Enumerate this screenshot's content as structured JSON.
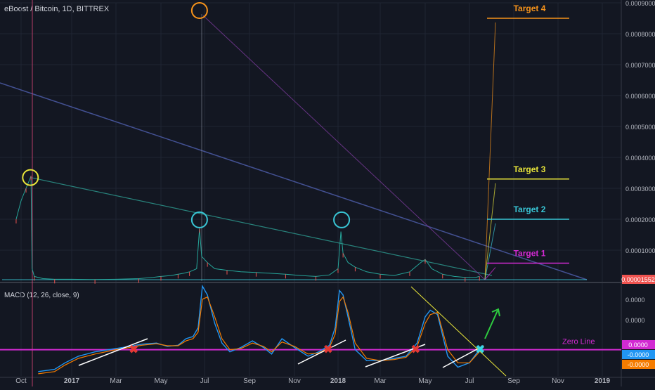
{
  "chart_data": {
    "type": "line",
    "title": "eBoost / Bitcoin, 1D, BITTREX",
    "x_ticks": [
      "Oct",
      "2017",
      "Mar",
      "May",
      "Jul",
      "Sep",
      "Nov",
      "2018",
      "Mar",
      "May",
      "Jul",
      "Sep",
      "Nov",
      "2019"
    ],
    "y_ticks": [
      "0.00090000",
      "0.00080000",
      "0.00070000",
      "0.00060000",
      "0.00050000",
      "0.00040000",
      "0.00030000",
      "0.00020000",
      "0.00010000"
    ],
    "ylim": [
      0,
      0.0009
    ],
    "last_price": "0.00001552",
    "price_series": {
      "x": [
        "2016-09-22",
        "2016-10-01",
        "2016-10-10",
        "2016-10-17",
        "2016-10-19",
        "2016-10-21",
        "2016-10-25",
        "2016-11-10",
        "2016-12-01",
        "2017-01-01",
        "2017-02-01",
        "2017-03-01",
        "2017-04-01",
        "2017-04-20",
        "2017-05-01",
        "2017-05-15",
        "2017-05-25",
        "2017-06-01",
        "2017-06-10",
        "2017-06-20",
        "2017-06-24",
        "2017-06-27",
        "2017-07-05",
        "2017-07-15",
        "2017-08-01",
        "2017-08-20",
        "2017-09-10",
        "2017-10-01",
        "2017-10-20",
        "2017-11-10",
        "2017-12-01",
        "2017-12-20",
        "2018-01-01",
        "2018-01-05",
        "2018-01-08",
        "2018-01-15",
        "2018-01-25",
        "2018-02-10",
        "2018-03-01",
        "2018-03-20",
        "2018-04-10",
        "2018-04-25",
        "2018-05-01",
        "2018-05-10",
        "2018-05-25",
        "2018-06-10",
        "2018-06-25",
        "2018-07-10",
        "2018-07-15"
      ],
      "y": [
        0.0002,
        0.00026,
        0.0003,
        0.00033,
        0.00034,
        4e-05,
        1.5e-05,
        8e-06,
        6e-06,
        6e-06,
        5e-06,
        6e-06,
        8e-06,
        1.2e-05,
        1.5e-05,
        1.8e-05,
        2.2e-05,
        2.5e-05,
        3e-05,
        4e-05,
        0.00017,
        8e-05,
        6e-05,
        4e-05,
        3.5e-05,
        3e-05,
        2.8e-05,
        2.5e-05,
        2.2e-05,
        1.8e-05,
        1.5e-05,
        2e-05,
        4e-05,
        0.00016,
        9e-05,
        6e-05,
        4.5e-05,
        3e-05,
        2.2e-05,
        1.8e-05,
        3e-05,
        6e-05,
        7e-05,
        4e-05,
        2.2e-05,
        1.5e-05,
        1.2e-05,
        1.2e-05,
        1.5e-05
      ]
    },
    "markers": [
      {
        "date": "2016-10-18",
        "price": 0.000335,
        "color": "#e8e53a"
      },
      {
        "date": "2017-06-24",
        "price": 0.000875,
        "color": "#f7931a"
      },
      {
        "date": "2017-06-24",
        "price": 0.000198,
        "color": "#39c7d6"
      },
      {
        "date": "2018-01-06",
        "price": 0.000198,
        "color": "#39c7d6"
      }
    ],
    "targets": [
      {
        "label": "Target 4",
        "price": 0.00085,
        "color": "#f7931a"
      },
      {
        "label": "Target 3",
        "price": 0.00033,
        "color": "#e8e53a"
      },
      {
        "label": "Target 2",
        "price": 0.0002,
        "color": "#39c7d6"
      },
      {
        "label": "Target 1",
        "price": 5.8e-05,
        "color": "#d22ad2"
      }
    ],
    "macd": {
      "label": "MACD (12, 26, close, 9)",
      "zero_line_label": "Zero Line",
      "y_ticks": [
        "0.0000",
        "0.0000"
      ],
      "value_badges": [
        {
          "text": "0.0000",
          "color": "#d22ad2"
        },
        {
          "text": "-0.0000",
          "color": "#2196f3"
        },
        {
          "text": "-0.0000",
          "color": "#f57c00"
        }
      ],
      "x": [
        "2016-11-01",
        "2016-12-01",
        "2016-12-20",
        "2017-01-10",
        "2017-02-01",
        "2017-03-01",
        "2017-03-20",
        "2017-04-05",
        "2017-04-25",
        "2017-05-10",
        "2017-05-25",
        "2017-06-05",
        "2017-06-15",
        "2017-06-22",
        "2017-06-28",
        "2017-07-05",
        "2017-07-15",
        "2017-07-25",
        "2017-08-05",
        "2017-08-20",
        "2017-09-05",
        "2017-09-20",
        "2017-10-01",
        "2017-10-15",
        "2017-11-01",
        "2017-11-20",
        "2017-12-05",
        "2017-12-20",
        "2017-12-28",
        "2018-01-03",
        "2018-01-08",
        "2018-01-15",
        "2018-01-25",
        "2018-02-10",
        "2018-03-01",
        "2018-03-20",
        "2018-04-05",
        "2018-04-20",
        "2018-05-01",
        "2018-05-08",
        "2018-05-18",
        "2018-06-01",
        "2018-06-15",
        "2018-07-01",
        "2018-07-15"
      ],
      "macd": [
        -1.0,
        -0.9,
        -0.6,
        -0.3,
        -0.1,
        0.05,
        0.15,
        0.25,
        0.3,
        0.15,
        0.2,
        0.5,
        0.6,
        1.0,
        2.9,
        2.5,
        1.2,
        0.3,
        -0.1,
        0.1,
        0.4,
        0.1,
        -0.2,
        0.5,
        0.1,
        -0.3,
        -0.1,
        0.2,
        1.0,
        2.7,
        2.5,
        1.5,
        0.0,
        -0.5,
        -0.5,
        -0.4,
        -0.3,
        0.3,
        1.5,
        1.8,
        1.6,
        -0.3,
        -0.8,
        -0.6,
        0.0
      ],
      "signal": [
        -1.1,
        -1.0,
        -0.7,
        -0.4,
        -0.2,
        0.0,
        0.1,
        0.2,
        0.27,
        0.18,
        0.18,
        0.4,
        0.5,
        0.8,
        2.3,
        2.4,
        1.5,
        0.5,
        0.0,
        0.05,
        0.3,
        0.15,
        -0.1,
        0.35,
        0.15,
        -0.2,
        -0.15,
        0.1,
        0.7,
        2.2,
        2.4,
        1.7,
        0.3,
        -0.4,
        -0.5,
        -0.45,
        -0.35,
        0.15,
        1.2,
        1.6,
        1.7,
        0.0,
        -0.6,
        -0.6,
        -0.1
      ],
      "cross_dates": [
        "2017-03-25",
        "2017-12-18",
        "2018-04-18"
      ],
      "breakout_date": "2018-07-16"
    }
  }
}
